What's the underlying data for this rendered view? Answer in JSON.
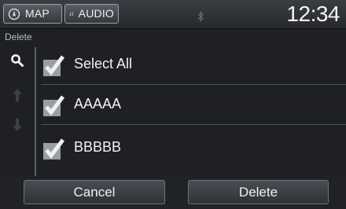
{
  "status_bar": {
    "map_label": "MAP",
    "audio_label": "AUDIO",
    "clock": "12:34"
  },
  "screen_title": "Delete",
  "list": {
    "items": [
      {
        "label": "Select All",
        "checked": true
      },
      {
        "label": "AAAAA",
        "checked": true
      },
      {
        "label": "BBBBB",
        "checked": true
      }
    ]
  },
  "actions": {
    "cancel_label": "Cancel",
    "delete_label": "Delete"
  },
  "rail_icons": [
    "search-icon",
    "scroll-up-icon",
    "scroll-down-icon"
  ],
  "colors": {
    "background": "#1e2024",
    "text": "#f2f2f2",
    "checkmark": "#e6e6e6"
  }
}
